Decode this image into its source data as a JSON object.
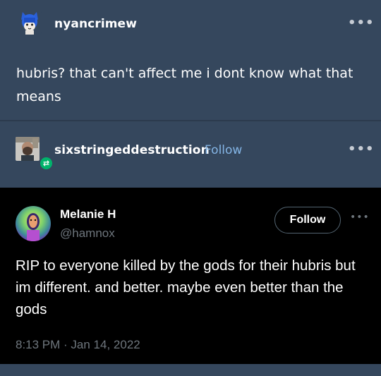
{
  "post": {
    "author": "nyancrimew",
    "author_avatar": "cat-character-avatar",
    "menu_icon": "more-dots-icon",
    "text": "hubris? that can't affect me i dont know what that means",
    "reblog": {
      "author": "sixstringeddestruction",
      "follow_label": "Follow",
      "author_avatar": "bearded-man-avatar",
      "badge_icon": "reblog-icon",
      "menu_icon": "more-dots-icon"
    }
  },
  "tweet": {
    "display_name": "Melanie H",
    "handle": "@hamnox",
    "avatar": "neon-portrait-avatar",
    "follow_label": "Follow",
    "more_icon": "more-dots-icon",
    "text": "RIP to everyone killed by the gods for their hubris but im different. and better. maybe even better than the gods",
    "timestamp": "8:13 PM · Jan 14, 2022"
  },
  "colors": {
    "background": "#35475d",
    "tweet_background": "#000000",
    "link": "#84b5e5",
    "muted": "#6e767d",
    "reblog_green": "#00b36b"
  }
}
